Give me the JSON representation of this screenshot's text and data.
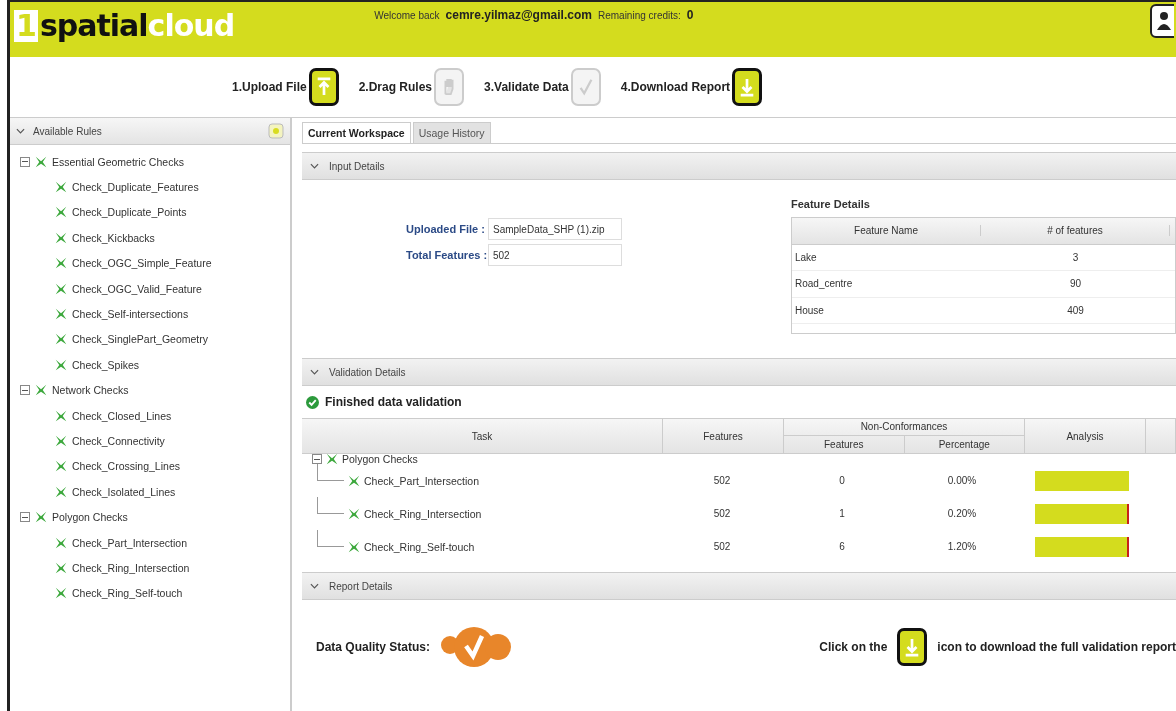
{
  "header": {
    "logo_digit": "1",
    "logo_word_1": "spatial",
    "logo_word_2": "cloud",
    "welcome": "Welcome back",
    "user": "cemre.yilmaz@gmail.com",
    "credits_label": "Remaining credits:",
    "credits": "0"
  },
  "steps": [
    {
      "label": "1.Upload File",
      "kind": "upload",
      "disabled": false
    },
    {
      "label": "2.Drag Rules",
      "kind": "drag",
      "disabled": true
    },
    {
      "label": "3.Validate Data",
      "kind": "validate",
      "disabled": true
    },
    {
      "label": "4.Download Report",
      "kind": "download",
      "disabled": false
    }
  ],
  "sidebar": {
    "title": "Available Rules",
    "groups": [
      {
        "label": "Essential Geometric Checks",
        "expanded": true,
        "children": [
          "Check_Duplicate_Features",
          "Check_Duplicate_Points",
          "Check_Kickbacks",
          "Check_OGC_Simple_Feature",
          "Check_OGC_Valid_Feature",
          "Check_Self-intersections",
          "Check_SinglePart_Geometry",
          "Check_Spikes"
        ]
      },
      {
        "label": "Network Checks",
        "expanded": true,
        "children": [
          "Check_Closed_Lines",
          "Check_Connectivity",
          "Check_Crossing_Lines",
          "Check_Isolated_Lines"
        ]
      },
      {
        "label": "Polygon Checks",
        "expanded": true,
        "children": [
          "Check_Part_Intersection",
          "Check_Ring_Intersection",
          "Check_Ring_Self-touch"
        ]
      }
    ]
  },
  "tabs": [
    {
      "label": "Current Workspace",
      "selected": true
    },
    {
      "label": "Usage History",
      "selected": false
    }
  ],
  "input_details": {
    "title": "Input Details",
    "fields": [
      {
        "label": "Uploaded File :",
        "value": "SampleData_SHP (1).zip"
      },
      {
        "label": "Total Features :",
        "value": "502"
      }
    ],
    "feature_details": {
      "title": "Feature Details",
      "columns": [
        "Feature Name",
        "# of features"
      ],
      "rows": [
        [
          "Lake",
          "3"
        ],
        [
          "Road_centre",
          "90"
        ],
        [
          "House",
          "409"
        ]
      ]
    }
  },
  "validation_details": {
    "title": "Validation Details",
    "status": "Finished data validation",
    "columns": {
      "task": "Task",
      "features": "Features",
      "group": "Non-Conformances",
      "nc_features": "Features",
      "percentage": "Percentage",
      "analysis": "Analysis"
    },
    "groups": [
      {
        "label": "Polygon Checks",
        "expanded": true,
        "children": [
          {
            "task": "Check_Part_Intersection",
            "features": "502",
            "nc_features": "0",
            "percentage": "0.00%",
            "level": 1.0
          },
          {
            "task": "Check_Ring_Intersection",
            "features": "502",
            "nc_features": "1",
            "percentage": "0.20%",
            "level": 0.98
          },
          {
            "task": "Check_Ring_Self-touch",
            "features": "502",
            "nc_features": "6",
            "percentage": "1.20%",
            "level": 0.98
          }
        ]
      }
    ]
  },
  "report_details": {
    "title": "Report Details",
    "status_label": "Data Quality Status:",
    "hint_before": "Click on the",
    "hint_after": "icon to download the full validation report"
  }
}
